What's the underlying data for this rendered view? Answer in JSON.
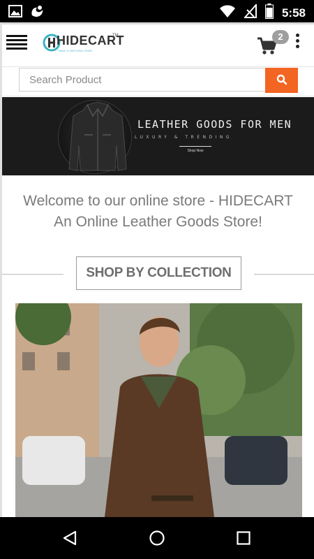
{
  "status_bar": {
    "time": "5:58",
    "icons": [
      "image-icon",
      "uc-browser-icon",
      "wifi-icon",
      "signal-icon",
      "battery-icon"
    ]
  },
  "header": {
    "logo_text": "HIDECART",
    "logo_tagline": "TAKE A NATURAL RIDE...",
    "logo_tm": "TM",
    "cart_count": "2"
  },
  "search": {
    "placeholder": "Search Product"
  },
  "banner": {
    "title": "LEATHER GOODS FOR MEN",
    "subtitle": "LUXURY & TRENDING",
    "cta": "Shop Now"
  },
  "welcome": {
    "line1": "Welcome to our online store - HIDECART",
    "line2": "An Online Leather Goods Store!"
  },
  "collection": {
    "label": "SHOP BY COLLECTION"
  },
  "colors": {
    "accent": "#f26522",
    "badge": "#9e9e9e",
    "brand_teal": "#3fb2c4"
  }
}
